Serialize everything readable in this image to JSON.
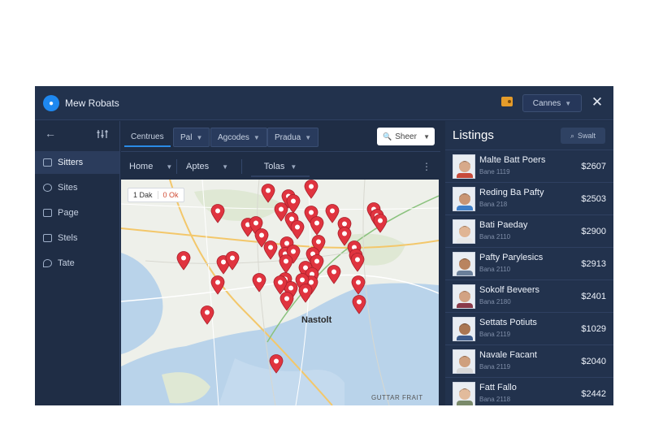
{
  "app": {
    "title": "Mew Robats",
    "logo_icon": "location-icon"
  },
  "header": {
    "currency_label": "Cannes",
    "close_icon": "close-icon"
  },
  "sidebar": {
    "items": [
      {
        "label": "Sitters",
        "icon": "calendar-icon",
        "active": true
      },
      {
        "label": "Sites",
        "icon": "settings-icon",
        "active": false
      },
      {
        "label": "Page",
        "icon": "image-icon",
        "active": false
      },
      {
        "label": "Stels",
        "icon": "list-icon",
        "active": false
      },
      {
        "label": "Tate",
        "icon": "pin-icon",
        "active": false
      }
    ]
  },
  "filters": {
    "row1": [
      {
        "label": "Centrues"
      },
      {
        "label": "Pal"
      },
      {
        "label": "Agcodes"
      },
      {
        "label": "Pradua"
      }
    ],
    "search_placeholder": "Sheer",
    "row2": [
      {
        "label": "Home"
      },
      {
        "label": "Aptes"
      },
      {
        "label": "Tolas"
      }
    ]
  },
  "map": {
    "zoom_in": "1 Dak",
    "zoom_out": "0 Ok",
    "city_label": "Nastolt",
    "attribution": "GUTTAR FRAIT"
  },
  "listings": {
    "title": "Listings",
    "search_label": "Swalt",
    "rows": [
      {
        "name": "Malte Batt Poers",
        "sub": "Bane 1119",
        "price": "$2607"
      },
      {
        "name": "Reding Ba Pafty",
        "sub": "Bana 218",
        "price": "$2503"
      },
      {
        "name": "Bati Paeday",
        "sub": "Bana 2110",
        "price": "$2900"
      },
      {
        "name": "Pafty Parylesics",
        "sub": "Bana 2110",
        "price": "$2913"
      },
      {
        "name": "Sokolf Beveers",
        "sub": "Bana 2180",
        "price": "$2401"
      },
      {
        "name": "Settats Potiuts",
        "sub": "Bana 2119",
        "price": "$1029"
      },
      {
        "name": "Navale Facant",
        "sub": "Bana 2119",
        "price": "$2040"
      },
      {
        "name": "Fatt Fallo",
        "sub": "Bana 2118",
        "price": "$2442"
      }
    ]
  },
  "colors": {
    "accent": "#2a8be6",
    "pin": "#e0343f",
    "panel": "#1f2d45"
  }
}
